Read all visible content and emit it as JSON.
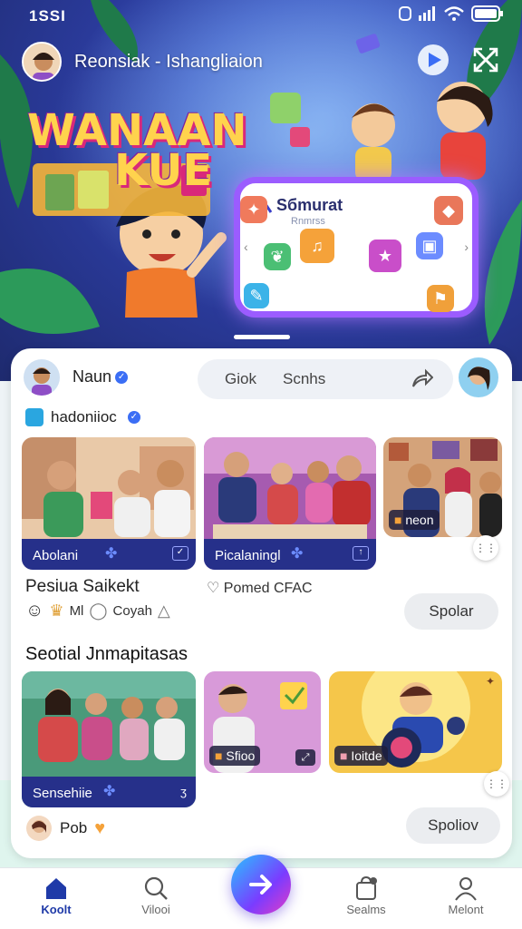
{
  "status_bar": {
    "time": "1SSI",
    "icons": [
      "nfc-icon",
      "signal-icon",
      "wifi-icon",
      "battery-icon"
    ]
  },
  "header": {
    "title": "Reonsiak - Ishangliaion"
  },
  "hero": {
    "brand_line1": "WANAAN",
    "brand_line2": "KUE",
    "card_title": "Sбmurat",
    "card_subtitle": "Rnmrss"
  },
  "user": {
    "name": "Naun",
    "pill_left": "Giok",
    "pill_right": "Scnhs"
  },
  "tag_line": {
    "label": "hadoniioc"
  },
  "cards_top": [
    {
      "label": "Abolani"
    },
    {
      "label": "Picalaningl"
    },
    {
      "label": "neon"
    }
  ],
  "post": {
    "title": "Pesiua Saikekt",
    "meta": "Pomed CFAC",
    "emoji_text_1": "Ml",
    "emoji_text_2": "Coyah",
    "button": "Spolar"
  },
  "section": {
    "title": "Seotial Jnmapitasas"
  },
  "cards_bottom": [
    {
      "label": "Sensehiie"
    },
    {
      "label": "Sfioo"
    },
    {
      "label": "Ioitde"
    }
  ],
  "footer_post": {
    "name": "Pob",
    "button": "Spoliov"
  },
  "nav": {
    "items": [
      {
        "label": "Koolt",
        "icon": "home-icon"
      },
      {
        "label": "Vilooi",
        "icon": "search-icon"
      },
      {
        "label": "Sealms",
        "icon": "bag-icon"
      },
      {
        "label": "Melont",
        "icon": "profile-icon"
      }
    ]
  },
  "colors": {
    "accent": "#2a3a9a",
    "card_bar": "#26308a",
    "fab_start": "#28c4ff",
    "fab_end": "#e43dc5"
  }
}
